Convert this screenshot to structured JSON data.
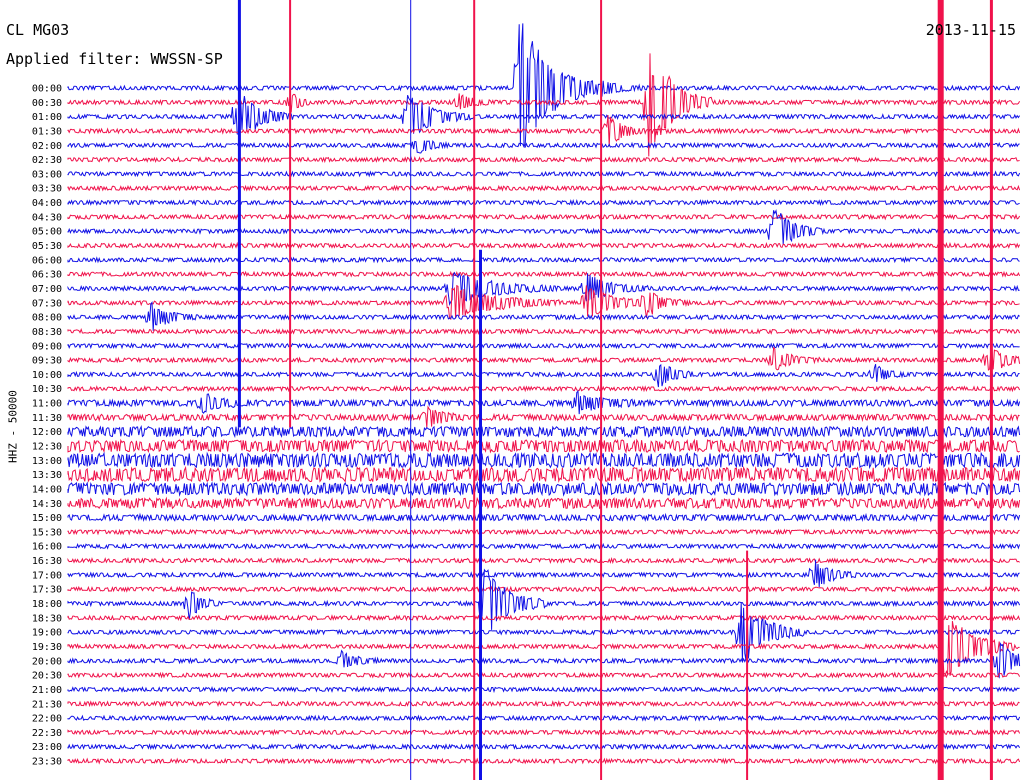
{
  "header": {
    "station": "CL MG03",
    "filter": "Applied filter: WWSSN-SP",
    "date": "2013-11-15"
  },
  "chart_data": {
    "type": "line",
    "title": "CL MG03",
    "subtitle": "Applied filter: WWSSN-SP",
    "date": "2013-11-15",
    "ylabel": "HHZ - 50000",
    "xlabel": "",
    "line_times": [
      "00:00",
      "00:30",
      "01:00",
      "01:30",
      "02:00",
      "02:30",
      "03:00",
      "03:30",
      "04:00",
      "04:30",
      "05:00",
      "05:30",
      "06:00",
      "06:30",
      "07:00",
      "07:30",
      "08:00",
      "08:30",
      "09:00",
      "09:30",
      "10:00",
      "10:30",
      "11:00",
      "11:30",
      "12:00",
      "12:30",
      "13:00",
      "13:30",
      "14:00",
      "14:30",
      "15:00",
      "15:30",
      "16:00",
      "16:30",
      "17:00",
      "17:30",
      "18:00",
      "18:30",
      "19:00",
      "19:30",
      "20:00",
      "20:30",
      "21:00",
      "21:30",
      "22:00",
      "22:30",
      "23:00",
      "23:30"
    ],
    "series_colors": [
      "#1010e6",
      "#f0124b"
    ],
    "minutes_per_line": 30,
    "noise_amplitude": [
      2,
      2,
      2,
      2,
      2,
      2,
      2,
      2,
      2,
      2,
      2,
      2,
      2,
      2,
      2,
      2,
      2,
      2,
      2,
      2,
      2,
      2,
      3,
      3,
      5,
      6,
      7,
      7,
      6,
      5,
      3,
      2,
      2,
      2,
      2,
      2,
      2,
      2,
      2,
      2,
      2,
      2,
      2,
      2,
      2,
      2,
      2,
      2
    ],
    "events": [
      {
        "line": 0,
        "minute": 14.2,
        "amplitude": 80,
        "duration": 2.5
      },
      {
        "line": 0,
        "minute": 16.8,
        "amplitude": 8,
        "duration": 1.5
      },
      {
        "line": 1,
        "minute": 7.0,
        "amplitude": 14,
        "duration": 0.6
      },
      {
        "line": 1,
        "minute": 18.3,
        "amplitude": 60,
        "duration": 2.0
      },
      {
        "line": 2,
        "minute": 5.3,
        "amplitude": 30,
        "duration": 1.8
      },
      {
        "line": 2,
        "minute": 10.7,
        "amplitude": 25,
        "duration": 2.0
      },
      {
        "line": 1,
        "minute": 12.3,
        "amplitude": 10,
        "duration": 1.0
      },
      {
        "line": 3,
        "minute": 17.0,
        "amplitude": 18,
        "duration": 1.2
      },
      {
        "line": 4,
        "minute": 11.0,
        "amplitude": 10,
        "duration": 1.0
      },
      {
        "line": 10,
        "minute": 22.2,
        "amplitude": 26,
        "duration": 1.6
      },
      {
        "line": 14,
        "minute": 12.0,
        "amplitude": 18,
        "duration": 3.5
      },
      {
        "line": 15,
        "minute": 12.0,
        "amplitude": 20,
        "duration": 3.5
      },
      {
        "line": 14,
        "minute": 16.3,
        "amplitude": 16,
        "duration": 2.0
      },
      {
        "line": 15,
        "minute": 16.3,
        "amplitude": 18,
        "duration": 2.2
      },
      {
        "line": 15,
        "minute": 18.2,
        "amplitude": 14,
        "duration": 1.4
      },
      {
        "line": 16,
        "minute": 2.6,
        "amplitude": 14,
        "duration": 1.5
      },
      {
        "line": 19,
        "minute": 22.2,
        "amplitude": 12,
        "duration": 1.5
      },
      {
        "line": 19,
        "minute": 29.0,
        "amplitude": 14,
        "duration": 1.5
      },
      {
        "line": 20,
        "minute": 18.6,
        "amplitude": 14,
        "duration": 1.2
      },
      {
        "line": 20,
        "minute": 25.4,
        "amplitude": 10,
        "duration": 1.0
      },
      {
        "line": 22,
        "minute": 4.2,
        "amplitude": 10,
        "duration": 1.5
      },
      {
        "line": 22,
        "minute": 16.0,
        "amplitude": 10,
        "duration": 2.0
      },
      {
        "line": 23,
        "minute": 11.3,
        "amplitude": 12,
        "duration": 1.2
      },
      {
        "line": 36,
        "minute": 3.8,
        "amplitude": 16,
        "duration": 1.0
      },
      {
        "line": 36,
        "minute": 13.1,
        "amplitude": 40,
        "duration": 2.0
      },
      {
        "line": 38,
        "minute": 21.2,
        "amplitude": 35,
        "duration": 2.0
      },
      {
        "line": 40,
        "minute": 8.6,
        "amplitude": 10,
        "duration": 1.2
      },
      {
        "line": 39,
        "minute": 27.6,
        "amplitude": 40,
        "duration": 2.2
      },
      {
        "line": 40,
        "minute": 29.3,
        "amplitude": 20,
        "duration": 1.5
      },
      {
        "line": 34,
        "minute": 23.5,
        "amplitude": 16,
        "duration": 1.4
      }
    ],
    "vertical_bursts": [
      {
        "minute": 5.4,
        "from_line": 0,
        "to_line": 23,
        "color": "#1010e6",
        "width": 3
      },
      {
        "minute": 7.0,
        "from_line": 0,
        "to_line": 23,
        "color": "#f0124b",
        "width": 2
      },
      {
        "minute": 10.8,
        "from_line": 0,
        "to_line": 47,
        "color": "#1010e6",
        "width": 1
      },
      {
        "minute": 12.8,
        "from_line": 0,
        "to_line": 47,
        "color": "#f0124b",
        "width": 2
      },
      {
        "minute": 13.0,
        "from_line": 12,
        "to_line": 47,
        "color": "#1010e6",
        "width": 3
      },
      {
        "minute": 16.8,
        "from_line": 0,
        "to_line": 47,
        "color": "#f0124b",
        "width": 2
      },
      {
        "minute": 21.4,
        "from_line": 33,
        "to_line": 47,
        "color": "#f0124b",
        "width": 2
      },
      {
        "minute": 27.5,
        "from_line": 0,
        "to_line": 47,
        "color": "#f0124b",
        "width": 6
      },
      {
        "minute": 29.1,
        "from_line": 0,
        "to_line": 47,
        "color": "#f0124b",
        "width": 3
      }
    ]
  }
}
